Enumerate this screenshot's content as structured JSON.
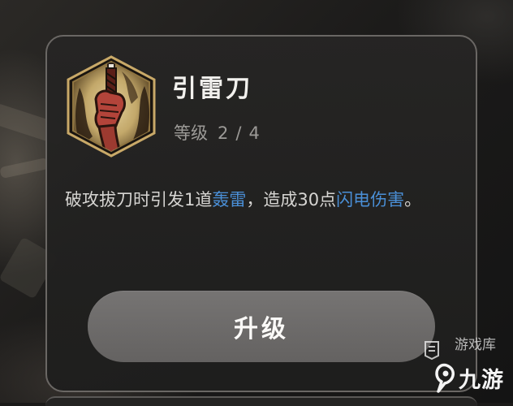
{
  "skill": {
    "name": "引雷刀",
    "level_label": "等级",
    "level_current": "2",
    "level_separator": "/",
    "level_max": "4",
    "description": {
      "part1": "破攻拔刀时引发1道",
      "keyword1": "轰雷",
      "part2": "，造成30点",
      "keyword2": "闪电伤害",
      "part3": "。"
    },
    "icon": "sword-grip-icon"
  },
  "actions": {
    "upgrade_label": "升级"
  },
  "watermark": {
    "top_text": "游戏库",
    "brand": "九游"
  },
  "colors": {
    "keyword": "#4a8fd6",
    "icon_frame": "#c9a968",
    "button": "#6e6c6b",
    "card_border": "#6a6764"
  }
}
